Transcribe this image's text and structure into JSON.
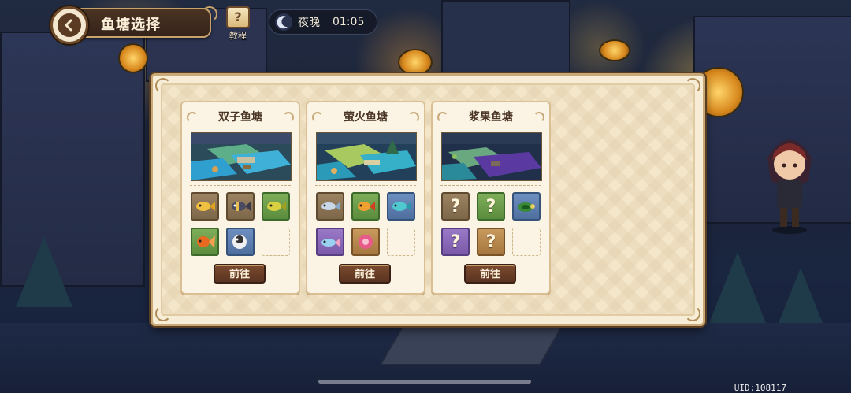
{
  "header": {
    "title": "鱼塘选择",
    "tutorial_label": "教程",
    "tutorial_glyph": "?",
    "time_period": "夜晚",
    "time": "01:05"
  },
  "ponds": [
    {
      "name": "双子鱼塘",
      "button_label": "前往",
      "fish_slots": [
        {
          "rarity": "common",
          "icon": "yellow-fish-icon"
        },
        {
          "rarity": "common",
          "icon": "striped-fish-icon"
        },
        {
          "rarity": "green",
          "icon": "green-fish-icon"
        },
        {
          "rarity": "green",
          "icon": "goldfish-icon"
        },
        {
          "rarity": "blue",
          "icon": "pufferfish-icon"
        },
        {
          "rarity": "empty",
          "icon": ""
        }
      ]
    },
    {
      "name": "萤火鱼塘",
      "button_label": "前往",
      "fish_slots": [
        {
          "rarity": "common",
          "icon": "silver-fish-icon"
        },
        {
          "rarity": "green",
          "icon": "orange-fish-icon"
        },
        {
          "rarity": "blue",
          "icon": "teal-fish-icon"
        },
        {
          "rarity": "purple",
          "icon": "rainbow-fish-icon"
        },
        {
          "rarity": "gold",
          "icon": "pink-flower-fish-icon"
        },
        {
          "rarity": "empty",
          "icon": ""
        }
      ]
    },
    {
      "name": "浆果鱼塘",
      "button_label": "前往",
      "fish_slots": [
        {
          "rarity": "common",
          "icon": "unknown-fish-icon",
          "glyph": "?"
        },
        {
          "rarity": "green",
          "icon": "unknown-fish-icon",
          "glyph": "?"
        },
        {
          "rarity": "blue",
          "icon": "turtle-fish-icon"
        },
        {
          "rarity": "purple",
          "icon": "unknown-fish-icon",
          "glyph": "?"
        },
        {
          "rarity": "gold",
          "icon": "unknown-fish-icon",
          "glyph": "?"
        },
        {
          "rarity": "empty",
          "icon": ""
        }
      ]
    }
  ],
  "footer": {
    "uid": "UID:108117"
  },
  "colors": {
    "panel_bg": "#f7ecd5",
    "button_bg": "#5a3320",
    "common": "#8b7355",
    "green": "#6a9e4a",
    "blue": "#5a7fb0",
    "purple": "#8a6ab8",
    "gold": "#b8864c"
  }
}
